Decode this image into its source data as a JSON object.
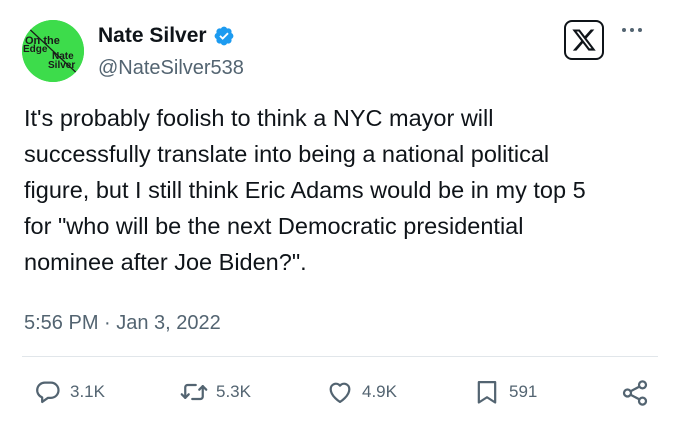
{
  "author": {
    "display_name": "Nate Silver",
    "handle": "@NateSilver538",
    "verified": true,
    "avatar_text": [
      "On the",
      "Edge",
      "Nate",
      "Silver"
    ],
    "avatar_color": "#3ddc4b"
  },
  "tweet": {
    "text": "It's probably foolish to think a NYC mayor will\nsuccessfully translate into being a national political\nfigure, but I still think Eric Adams would be in my top 5\nfor \"who will be the next Democratic presidential\nnominee after Joe Biden?\".",
    "timestamp": "5:56 PM · Jan 3, 2022"
  },
  "stats": {
    "replies": "3.1K",
    "retweets": "5.3K",
    "likes": "4.9K",
    "bookmarks": "591"
  },
  "icons": {
    "reply": "reply-icon",
    "retweet": "retweet-icon",
    "like": "heart-icon",
    "bookmark": "bookmark-icon",
    "share": "share-icon",
    "platform": "x-logo-icon",
    "more": "more-icon",
    "verified": "verified-badge-icon"
  },
  "colors": {
    "verified_blue": "#1d9bf0",
    "secondary_text": "#536471",
    "primary_text": "#0f1419"
  }
}
